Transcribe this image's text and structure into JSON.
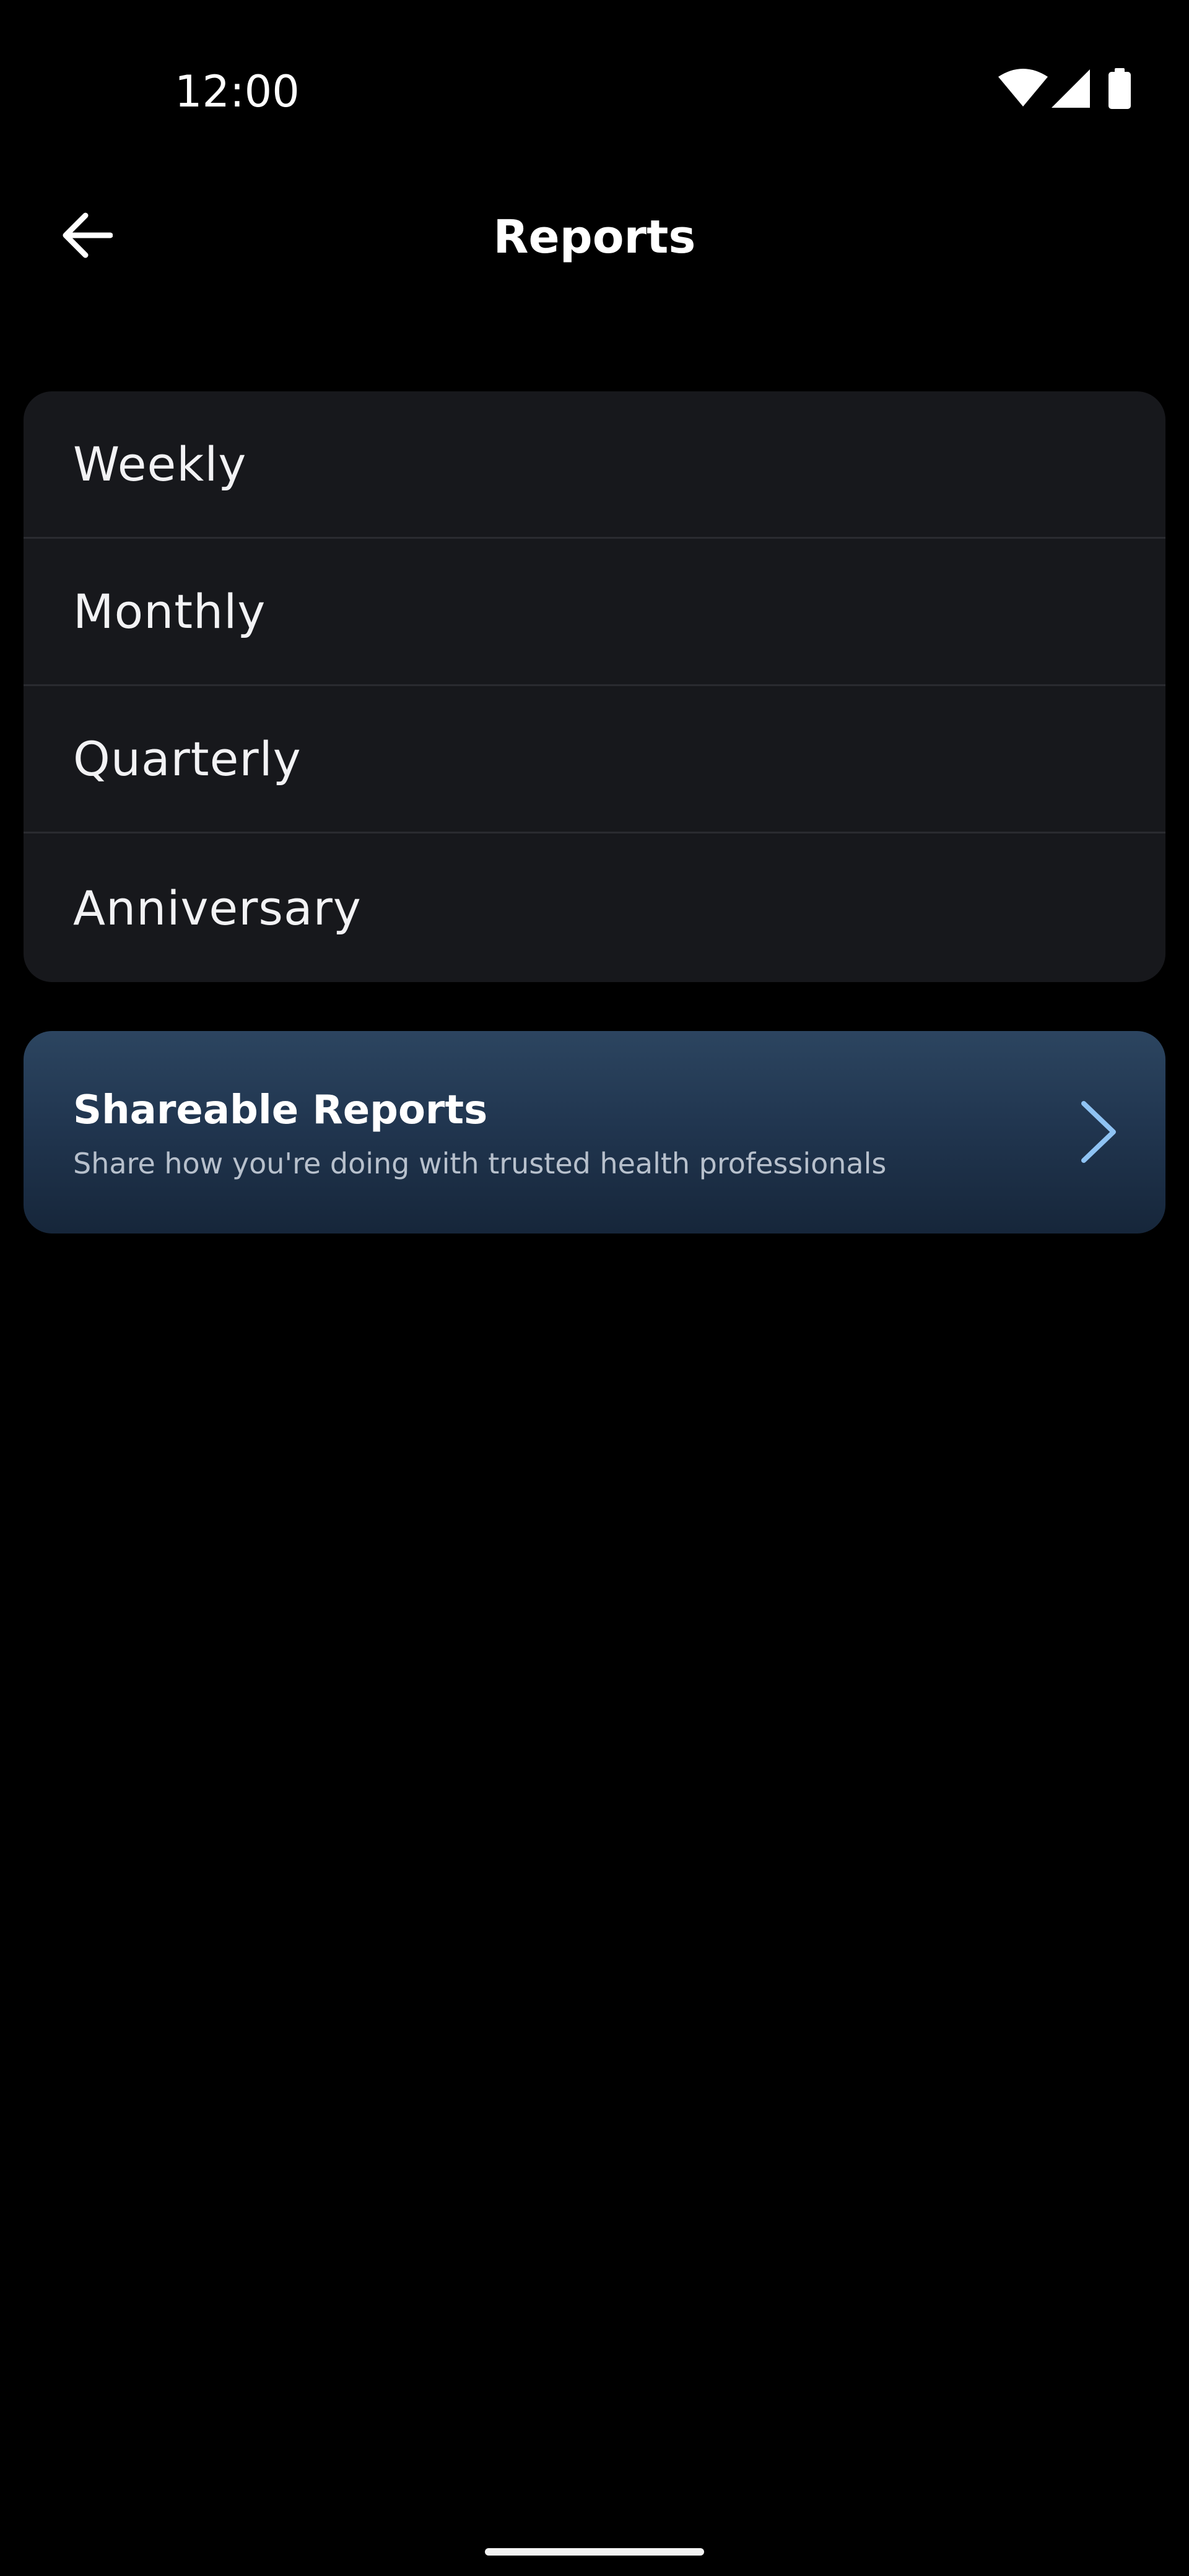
{
  "status_bar": {
    "time": "12:00",
    "icons": [
      "wifi-icon",
      "cellular-signal-icon",
      "battery-icon"
    ]
  },
  "app_bar": {
    "title": "Reports",
    "back_icon": "arrow-left-icon"
  },
  "periods": [
    {
      "label": "Weekly"
    },
    {
      "label": "Monthly"
    },
    {
      "label": "Quarterly"
    },
    {
      "label": "Anniversary"
    }
  ],
  "shareable": {
    "title": "Shareable Reports",
    "subtitle": "Share how you're doing with trusted health professionals",
    "icon": "chevron-right-icon"
  },
  "colors": {
    "background": "#000000",
    "card": "#17181c",
    "share_card_top": "#2c4560",
    "share_card_bottom": "#16263a",
    "chevron_accent": "#8fc3f3"
  }
}
